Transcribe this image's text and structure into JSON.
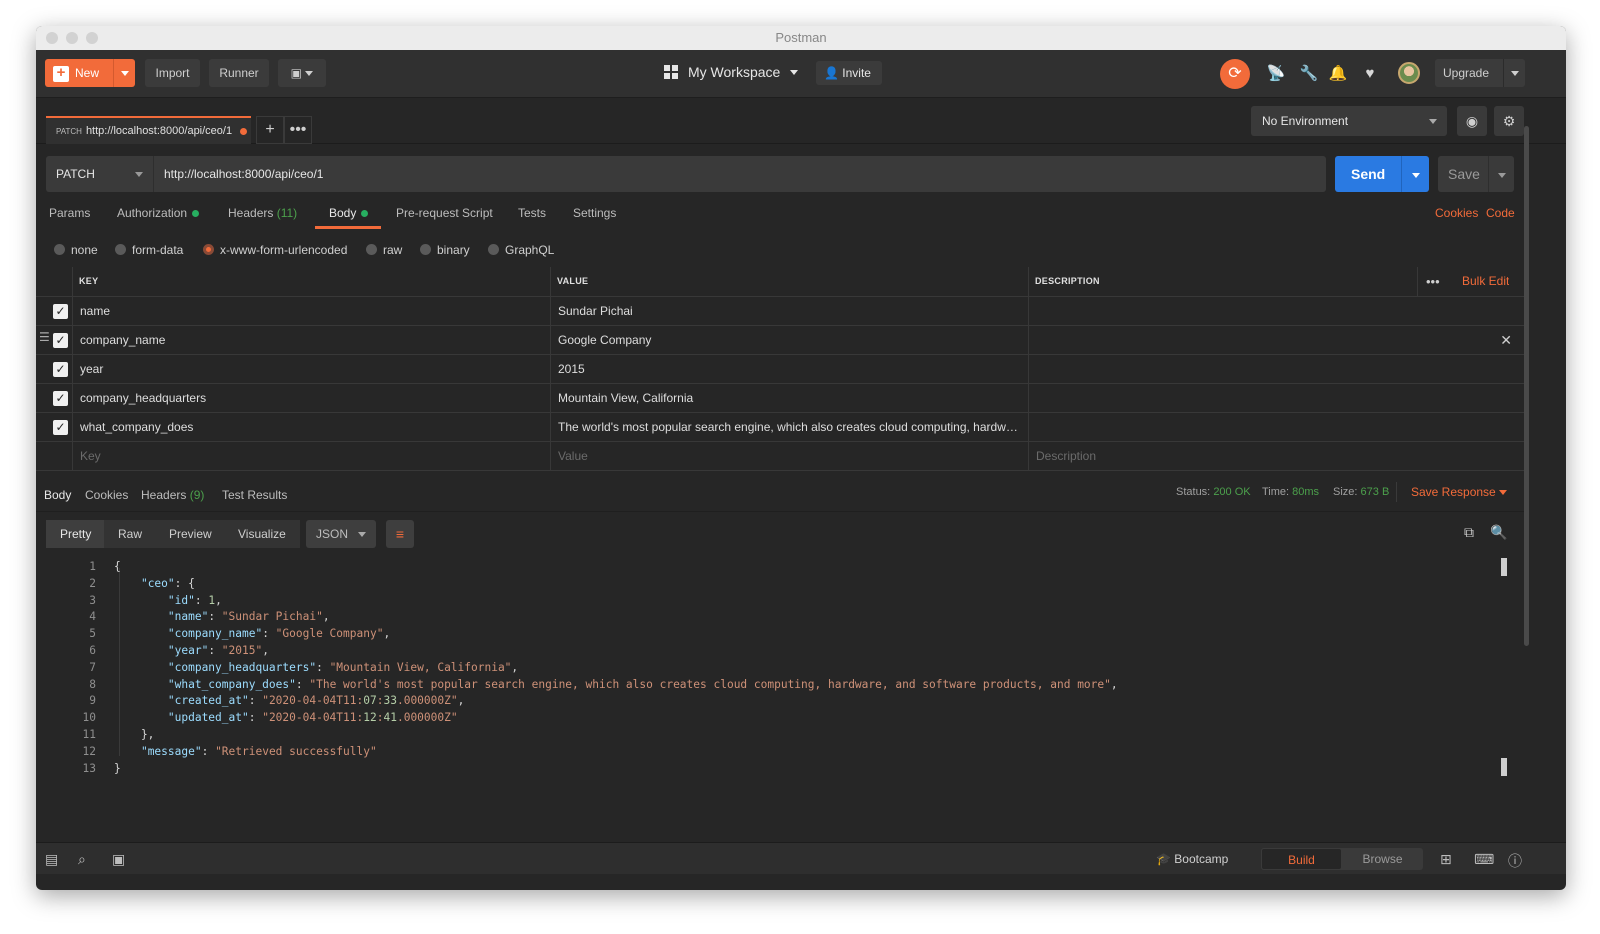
{
  "window": {
    "title": "Postman"
  },
  "header": {
    "new_label": "New",
    "import_label": "Import",
    "runner_label": "Runner",
    "workspace_label": "My Workspace",
    "invite_label": "Invite",
    "upgrade_label": "Upgrade"
  },
  "tab": {
    "method": "PATCH",
    "title": "http://localhost:8000/api/ceo/1"
  },
  "environment": {
    "selected": "No Environment"
  },
  "request": {
    "method": "PATCH",
    "url": "http://localhost:8000/api/ceo/1",
    "send_label": "Send",
    "save_label": "Save"
  },
  "request_tabs": {
    "params": "Params",
    "authorization": "Authorization",
    "headers": "Headers",
    "headers_count": "(11)",
    "body": "Body",
    "prerequest": "Pre-request Script",
    "tests": "Tests",
    "settings": "Settings",
    "cookies": "Cookies",
    "code": "Code"
  },
  "body_types": {
    "none": "none",
    "form_data": "form-data",
    "urlencoded": "x-www-form-urlencoded",
    "raw": "raw",
    "binary": "binary",
    "graphql": "GraphQL"
  },
  "params_table": {
    "col_key": "KEY",
    "col_value": "VALUE",
    "col_desc": "DESCRIPTION",
    "bulk_edit": "Bulk Edit",
    "rows": [
      {
        "key": "name",
        "value": "Sundar Pichai"
      },
      {
        "key": "company_name",
        "value": "Google Company"
      },
      {
        "key": "year",
        "value": "2015"
      },
      {
        "key": "company_headquarters",
        "value": "Mountain View, California"
      },
      {
        "key": "what_company_does",
        "value": "The world's most popular search engine, which also creates cloud computing, hardware and software products, and more"
      }
    ],
    "placeholder_key": "Key",
    "placeholder_value": "Value",
    "placeholder_desc": "Description"
  },
  "response_tabs": {
    "body": "Body",
    "cookies": "Cookies",
    "headers": "Headers",
    "headers_count": "(9)",
    "test_results": "Test Results"
  },
  "response_meta": {
    "status_label": "Status:",
    "status": "200 OK",
    "time_label": "Time:",
    "time": "80ms",
    "size_label": "Size:",
    "size": "673 B",
    "save_response": "Save Response"
  },
  "view_modes": {
    "pretty": "Pretty",
    "raw": "Raw",
    "preview": "Preview",
    "visualize": "Visualize",
    "format": "JSON"
  },
  "response_code": [
    "{",
    "    \"ceo\": {",
    "        \"id\": 1,",
    "        \"name\": \"Sundar Pichai\",",
    "        \"company_name\": \"Google Company\",",
    "        \"year\": \"2015\",",
    "        \"company_headquarters\": \"Mountain View, California\",",
    "        \"what_company_does\": \"The world's most popular search engine, which also creates cloud computing, hardware, and software products, and more\",",
    "        \"created_at\": \"2020-04-04T11:07:33.000000Z\",",
    "        \"updated_at\": \"2020-04-04T11:12:41.000000Z\"",
    "    },",
    "    \"message\": \"Retrieved successfully\"",
    "}"
  ],
  "footer": {
    "bootcamp": "Bootcamp",
    "build": "Build",
    "browse": "Browse"
  }
}
